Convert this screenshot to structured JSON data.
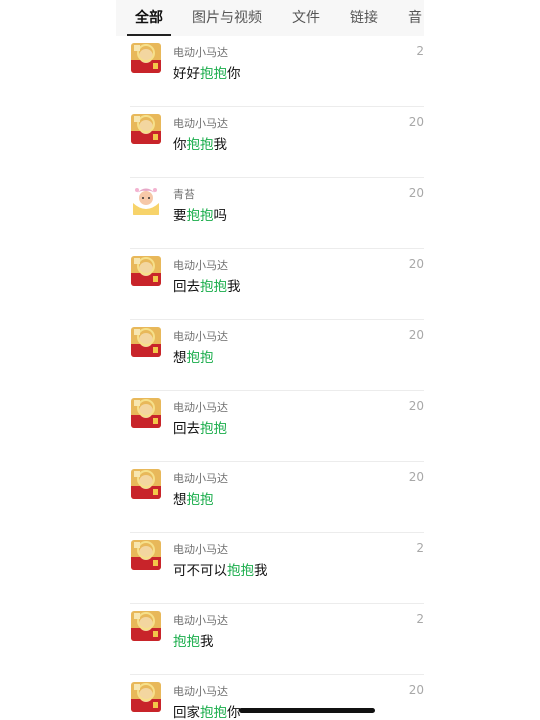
{
  "tabs": [
    {
      "label": "全部",
      "active": true
    },
    {
      "label": "图片与视频",
      "active": false
    },
    {
      "label": "文件",
      "active": false
    },
    {
      "label": "链接",
      "active": false
    },
    {
      "label": "音",
      "active": false
    }
  ],
  "messages": [
    {
      "sender": "电动小马达",
      "avatar": "red-sun-avatar",
      "date": "2",
      "parts": [
        "好好",
        "抱抱",
        "你"
      ]
    },
    {
      "sender": "电动小马达",
      "avatar": "red-sun-avatar",
      "date": "20",
      "parts": [
        "你",
        "抱抱",
        "我"
      ]
    },
    {
      "sender": "青苔",
      "avatar": "cartoon-avatar",
      "date": "20",
      "parts": [
        "要",
        "抱抱",
        "吗"
      ]
    },
    {
      "sender": "电动小马达",
      "avatar": "red-sun-avatar",
      "date": "20",
      "parts": [
        "回去",
        "抱抱",
        "我"
      ]
    },
    {
      "sender": "电动小马达",
      "avatar": "red-sun-avatar",
      "date": "20",
      "parts": [
        "想",
        "抱抱",
        ""
      ]
    },
    {
      "sender": "电动小马达",
      "avatar": "red-sun-avatar",
      "date": "20",
      "parts": [
        "回去",
        "抱抱",
        ""
      ]
    },
    {
      "sender": "电动小马达",
      "avatar": "red-sun-avatar",
      "date": "20",
      "parts": [
        "想",
        "抱抱",
        ""
      ]
    },
    {
      "sender": "电动小马达",
      "avatar": "red-sun-avatar",
      "date": "2",
      "parts": [
        "可不可以",
        "抱抱",
        "我"
      ]
    },
    {
      "sender": "电动小马达",
      "avatar": "red-sun-avatar",
      "date": "2",
      "parts": [
        "",
        "抱抱",
        "我"
      ]
    },
    {
      "sender": "电动小马达",
      "avatar": "red-sun-avatar",
      "date": "20",
      "parts": [
        "回家",
        "抱抱",
        "你"
      ]
    }
  ],
  "colors": {
    "highlight": "#1aad4b",
    "tab_bar": "#f7f7f7",
    "separator": "#ececec"
  }
}
